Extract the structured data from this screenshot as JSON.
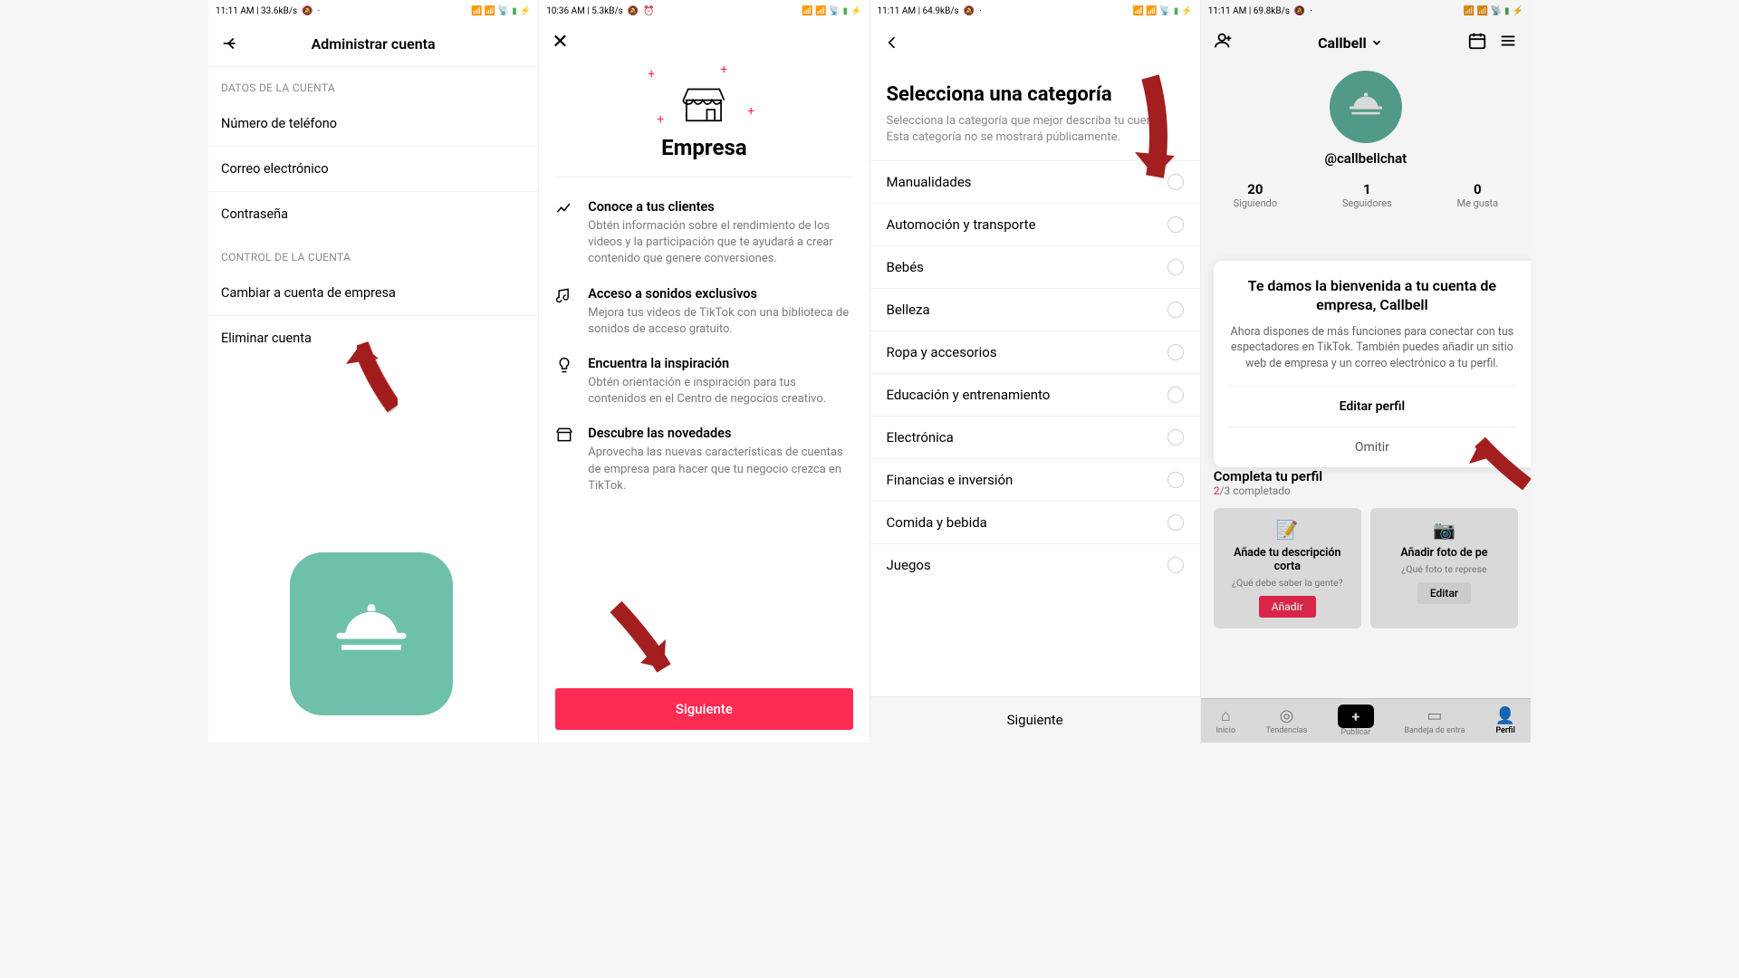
{
  "status": {
    "s1": "11:11 AM | 33.6kB/s",
    "s2": "10:36 AM | 5.3kB/s",
    "s3": "11:11 AM | 64.9kB/s",
    "s4": "11:11 AM | 69.8kB/s"
  },
  "screen1": {
    "title": "Administrar cuenta",
    "section1": "DATOS DE LA CUENTA",
    "i1": "Número de teléfono",
    "i2": "Correo electrónico",
    "i3": "Contraseña",
    "section2": "CONTROL DE LA CUENTA",
    "i4": "Cambiar a cuenta de empresa",
    "i5": "Eliminar cuenta"
  },
  "screen2": {
    "title": "Empresa",
    "f1t": "Conoce a tus clientes",
    "f1d": "Obtén información sobre el rendimiento de los videos y la participación que te ayudará a crear contenido que genere conversiones.",
    "f2t": "Acceso a sonidos exclusivos",
    "f2d": "Mejora tus videos de TikTok con una biblioteca de sonidos de acceso gratuito.",
    "f3t": "Encuentra la inspiración",
    "f3d": "Obtén orientación e inspiración para tus contenidos en el Centro de negocios creativo.",
    "f4t": "Descubre las novedades",
    "f4d": "Aprovecha las nuevas características de cuentas de empresa para hacer que tu negocio crezca en TikTok.",
    "next": "Siguiente"
  },
  "screen3": {
    "title": "Selecciona una categoría",
    "sub": "Selecciona la categoría que mejor describa tu cuenta. Esta categoría no se mostrará públicamente.",
    "cats": [
      "Manualidades",
      "Automoción y transporte",
      "Bebés",
      "Belleza",
      "Ropa y accesorios",
      "Educación y entrenamiento",
      "Electrónica",
      "Financias e inversión",
      "Comida y bebida",
      "Juegos"
    ],
    "next": "Siguiente"
  },
  "screen4": {
    "brand": "Callbell",
    "handle": "@callbellchat",
    "stats": {
      "following_n": "20",
      "following_l": "Siguiendo",
      "followers_n": "1",
      "followers_l": "Seguidores",
      "likes_n": "0",
      "likes_l": "Me gusta"
    },
    "modal_title": "Te damos la bienvenida a tu cuenta de empresa, Callbell",
    "modal_body": "Ahora dispones de más funciones para conectar con tus espectadores en TikTok. También puedes añadir un sitio web de empresa y un correo electrónico a tu perfil.",
    "edit": "Editar perfil",
    "skip": "Omitir",
    "pc_title": "Completa tu perfil",
    "pc_done": "2",
    "pc_total": "/3 completado",
    "card1_t": "Añade tu descripción corta",
    "card1_q": "¿Qué debe saber la gente?",
    "card1_b": "Añadir",
    "card2_t": "Añadir foto de pe",
    "card2_q": "¿Qué foto te represe",
    "card2_b": "Editar",
    "tabs": {
      "home": "Inicio",
      "trends": "Tendencias",
      "publish": "Publicar",
      "inbox": "Bandeja de entra",
      "profile": "Perfil"
    }
  }
}
